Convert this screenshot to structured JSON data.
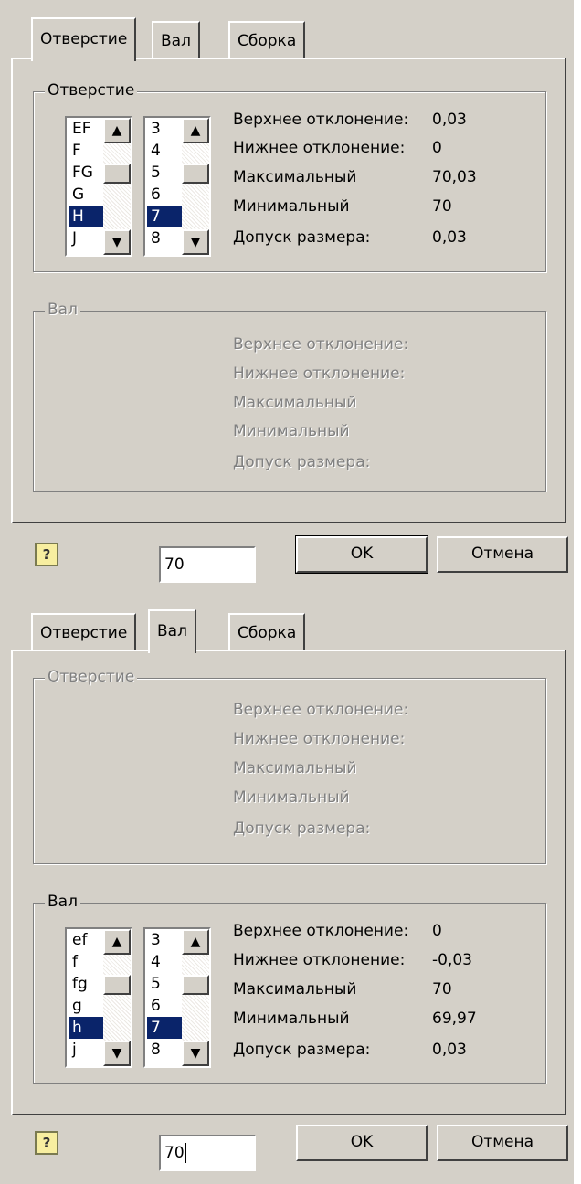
{
  "dialog1": {
    "tabs": [
      "Отверстие",
      "Вал",
      "Сборка"
    ],
    "active_tab": "Отверстие",
    "hole_group": {
      "title": "Отверстие",
      "letters": [
        "EF",
        "F",
        "FG",
        "G",
        "H",
        "J"
      ],
      "selected_letter": "H",
      "grades": [
        "3",
        "4",
        "5",
        "6",
        "7",
        "8"
      ],
      "selected_grade": "7",
      "labels": {
        "upper": "Верхнее отклонение:",
        "lower": "Нижнее отклонение:",
        "max": "Максимальный",
        "min": "Минимальный",
        "tol": "Допуск размера:"
      },
      "values": {
        "upper": "0,03",
        "lower": "0",
        "max": "70,03",
        "min": "70",
        "tol": "0,03"
      }
    },
    "shaft_group": {
      "title": "Вал",
      "labels": {
        "upper": "Верхнее отклонение:",
        "lower": "Нижнее отклонение:",
        "max": "Максимальный",
        "min": "Минимальный",
        "tol": "Допуск размера:"
      }
    },
    "size_input": "70",
    "ok_label": "OK",
    "cancel_label": "Отмена",
    "help_icon": "?"
  },
  "dialog2": {
    "tabs": [
      "Отверстие",
      "Вал",
      "Сборка"
    ],
    "active_tab": "Вал",
    "hole_group": {
      "title": "Отверстие",
      "labels": {
        "upper": "Верхнее отклонение:",
        "lower": "Нижнее отклонение:",
        "max": "Максимальный",
        "min": "Минимальный",
        "tol": "Допуск размера:"
      }
    },
    "shaft_group": {
      "title": "Вал",
      "letters": [
        "ef",
        "f",
        "fg",
        "g",
        "h",
        "j"
      ],
      "selected_letter": "h",
      "grades": [
        "3",
        "4",
        "5",
        "6",
        "7",
        "8"
      ],
      "selected_grade": "7",
      "labels": {
        "upper": "Верхнее отклонение:",
        "lower": "Нижнее отклонение:",
        "max": "Максимальный",
        "min": "Минимальный",
        "tol": "Допуск размера:"
      },
      "values": {
        "upper": "0",
        "lower": "-0,03",
        "max": "70",
        "min": "69,97",
        "tol": "0,03"
      }
    },
    "size_input": "70",
    "ok_label": "OK",
    "cancel_label": "Отмена",
    "help_icon": "?"
  }
}
